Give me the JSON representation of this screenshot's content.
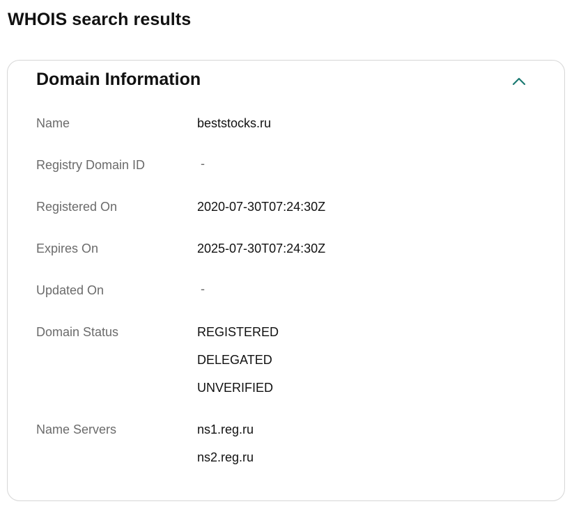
{
  "page": {
    "title": "WHOIS search results"
  },
  "domain_info": {
    "title": "Domain Information",
    "toggle_icon": "chevron-up-icon",
    "accent_color": "#1b7a72",
    "rows": {
      "name": {
        "label": "Name",
        "value": "beststocks.ru"
      },
      "registry_id": {
        "label": "Registry Domain ID",
        "value": "-"
      },
      "registered_on": {
        "label": "Registered On",
        "value": "2020-07-30T07:24:30Z"
      },
      "expires_on": {
        "label": "Expires On",
        "value": "2025-07-30T07:24:30Z"
      },
      "updated_on": {
        "label": "Updated On",
        "value": "-"
      },
      "domain_status": {
        "label": "Domain Status",
        "values": [
          "REGISTERED",
          "DELEGATED",
          "UNVERIFIED"
        ]
      },
      "name_servers": {
        "label": "Name Servers",
        "values": [
          "ns1.reg.ru",
          "ns2.reg.ru"
        ]
      }
    }
  }
}
